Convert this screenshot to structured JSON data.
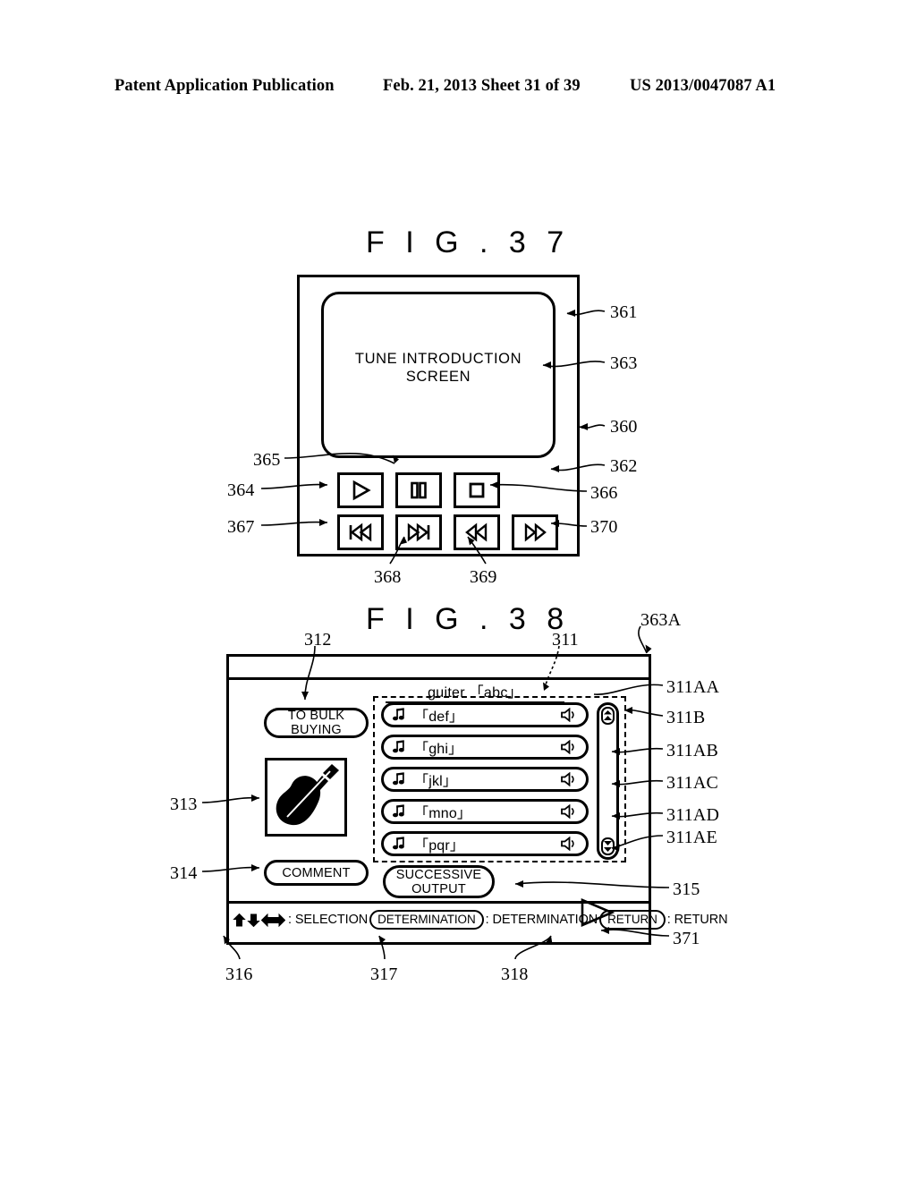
{
  "page_header": {
    "left": "Patent Application Publication",
    "middle": "Feb. 21, 2013  Sheet 31 of 39",
    "right": "US 2013/0047087 A1"
  },
  "fig37": {
    "title": "F I G . 3 7",
    "screen_text": "TUNE INTRODUCTION\nSCREEN",
    "screen_text_line1": "TUNE INTRODUCTION",
    "screen_text_line2": "SCREEN",
    "buttons": [
      {
        "name": "play-button",
        "icon": "play-icon"
      },
      {
        "name": "pause-button",
        "icon": "pause-icon"
      },
      {
        "name": "stop-button",
        "icon": "stop-icon"
      },
      {
        "name": "previous-button",
        "icon": "skip-backward-icon"
      },
      {
        "name": "next-button",
        "icon": "skip-forward-icon"
      },
      {
        "name": "rewind-button",
        "icon": "rewind-icon"
      },
      {
        "name": "fast-forward-button",
        "icon": "fast-forward-icon"
      }
    ],
    "refs": {
      "r361": "361",
      "r363": "363",
      "r360": "360",
      "r362": "362",
      "r366": "366",
      "r370": "370",
      "r365": "365",
      "r364": "364",
      "r367": "367",
      "r368": "368",
      "r369": "369"
    }
  },
  "fig38": {
    "title": "F I G . 3 8",
    "list_title": "guiter 「abc」",
    "bulk_buying_label_line1": "TO BULK",
    "bulk_buying_label_line2": "BUYING",
    "comment_label": "COMMENT",
    "successive_output_line1": "SUCCESSIVE",
    "successive_output_line2": "OUTPUT",
    "thumbnail_icon": "guitar-icon",
    "list_items": [
      {
        "label": "「def」",
        "note_icon": "music-note-icon",
        "speaker_icon": "speaker-icon"
      },
      {
        "label": "「ghi」",
        "note_icon": "music-note-icon",
        "speaker_icon": "speaker-icon"
      },
      {
        "label": "「jkl」",
        "note_icon": "music-note-icon",
        "speaker_icon": "speaker-icon"
      },
      {
        "label": "「mno」",
        "note_icon": "music-note-icon",
        "speaker_icon": "speaker-icon"
      },
      {
        "label": "「pqr」",
        "note_icon": "music-note-icon",
        "speaker_icon": "speaker-icon"
      }
    ],
    "scrollbar": {
      "up_icon": "double-chevron-up-icon",
      "down_icon": "double-chevron-down-icon"
    },
    "status_bar": {
      "dpad_icons": [
        "arrow-up-icon",
        "arrow-down-icon",
        "arrow-left-right-icon"
      ],
      "selection_text": ": SELECTION",
      "determination_button": "DETERMINATION",
      "determination_text": ": DETERMINATION",
      "return_button": "RETURN",
      "return_text": ": RETURN",
      "play_icon": "play-triangle-icon"
    },
    "refs": {
      "r312": "312",
      "r311": "311",
      "r363A": "363A",
      "r311AA": "311AA",
      "r311B": "311B",
      "r311AB": "311AB",
      "r311AC": "311AC",
      "r311AD": "311AD",
      "r311AE": "311AE",
      "r315": "315",
      "r313": "313",
      "r314": "314",
      "r316": "316",
      "r317": "317",
      "r318": "318",
      "r371": "371"
    }
  }
}
